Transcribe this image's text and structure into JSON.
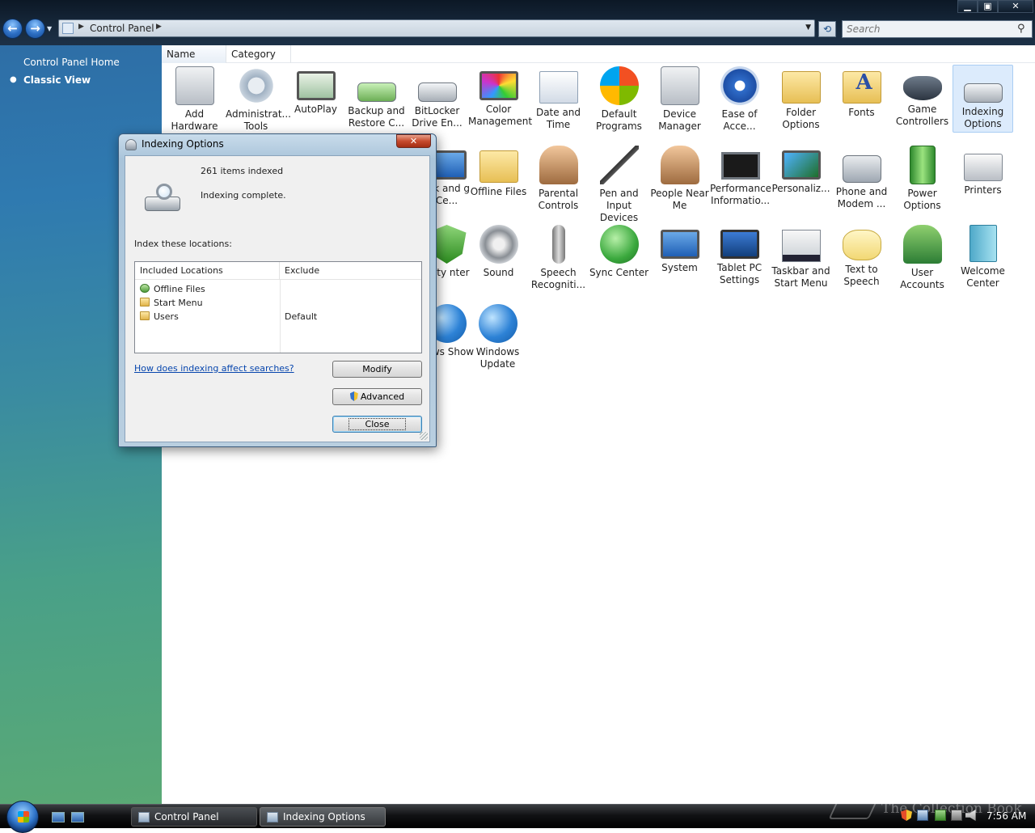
{
  "address": {
    "path": "Control Panel"
  },
  "search": {
    "placeholder": "Search"
  },
  "window_controls": {
    "minimize": "▁",
    "maximize": "▣",
    "close": "✕"
  },
  "sidebar": {
    "items": [
      {
        "label": "Control Panel Home"
      },
      {
        "label": "Classic View",
        "selected": true
      }
    ]
  },
  "columns": {
    "name": "Name",
    "category": "Category"
  },
  "control_panel_items": [
    {
      "label": "Add Hardware",
      "icon": "add-hardware-icon"
    },
    {
      "label": "Administrat... Tools",
      "icon": "administrative-tools-icon"
    },
    {
      "label": "AutoPlay",
      "icon": "autoplay-icon"
    },
    {
      "label": "Backup and Restore C...",
      "icon": "backup-icon"
    },
    {
      "label": "BitLocker Drive En...",
      "icon": "bitlocker-icon"
    },
    {
      "label": "Color Management",
      "icon": "color-management-icon"
    },
    {
      "label": "Date and Time",
      "icon": "date-time-icon"
    },
    {
      "label": "Default Programs",
      "icon": "default-programs-icon"
    },
    {
      "label": "Device Manager",
      "icon": "device-manager-icon"
    },
    {
      "label": "Ease of Acce...",
      "icon": "ease-of-access-icon"
    },
    {
      "label": "Folder Options",
      "icon": "folder-options-icon"
    },
    {
      "label": "Fonts",
      "icon": "fonts-icon"
    },
    {
      "label": "Game Controllers",
      "icon": "game-controllers-icon"
    },
    {
      "label": "Indexing Options",
      "icon": "indexing-options-icon",
      "selected": true
    },
    {
      "label": "ork and g Ce...",
      "icon": "network-center-icon"
    },
    {
      "label": "Offline Files",
      "icon": "offline-files-icon"
    },
    {
      "label": "Parental Controls",
      "icon": "parental-controls-icon"
    },
    {
      "label": "Pen and Input Devices",
      "icon": "pen-icon"
    },
    {
      "label": "People Near Me",
      "icon": "people-near-me-icon"
    },
    {
      "label": "Performance Informatio...",
      "icon": "performance-icon"
    },
    {
      "label": "Personaliz...",
      "icon": "personalization-icon"
    },
    {
      "label": "Phone and Modem ...",
      "icon": "phone-modem-icon"
    },
    {
      "label": "Power Options",
      "icon": "power-options-icon"
    },
    {
      "label": "Printers",
      "icon": "printers-icon"
    },
    {
      "label": "urity nter",
      "icon": "security-center-icon"
    },
    {
      "label": "Sound",
      "icon": "sound-icon"
    },
    {
      "label": "Speech Recogniti...",
      "icon": "speech-recognition-icon"
    },
    {
      "label": "Sync Center",
      "icon": "sync-center-icon"
    },
    {
      "label": "System",
      "icon": "system-icon"
    },
    {
      "label": "Tablet PC Settings",
      "icon": "tablet-pc-icon"
    },
    {
      "label": "Taskbar and Start Menu",
      "icon": "taskbar-icon"
    },
    {
      "label": "Text to Speech",
      "icon": "text-to-speech-icon"
    },
    {
      "label": "User Accounts",
      "icon": "user-accounts-icon"
    },
    {
      "label": "Welcome Center",
      "icon": "welcome-center-icon"
    },
    {
      "label": "dows Show",
      "icon": "windows-show-icon"
    },
    {
      "label": "Windows Update",
      "icon": "windows-update-icon"
    }
  ],
  "dialog": {
    "title": "Indexing Options",
    "close_label": "✕",
    "items_indexed": "261 items indexed",
    "status": "Indexing complete.",
    "locations_label": "Index these locations:",
    "list_headers": {
      "included": "Included Locations",
      "exclude": "Exclude"
    },
    "locations": [
      {
        "name": "Offline Files",
        "exclude": ""
      },
      {
        "name": "Start Menu",
        "exclude": ""
      },
      {
        "name": "Users",
        "exclude": "Default"
      }
    ],
    "help_link": "How does indexing affect searches?",
    "buttons": {
      "modify": "Modify",
      "advanced": "Advanced",
      "close": "Close"
    }
  },
  "taskbar": {
    "tasks": [
      {
        "label": "Control Panel"
      },
      {
        "label": "Indexing Options",
        "active": true
      }
    ],
    "clock": "7:56 AM",
    "watermark": "The Collection Book"
  }
}
